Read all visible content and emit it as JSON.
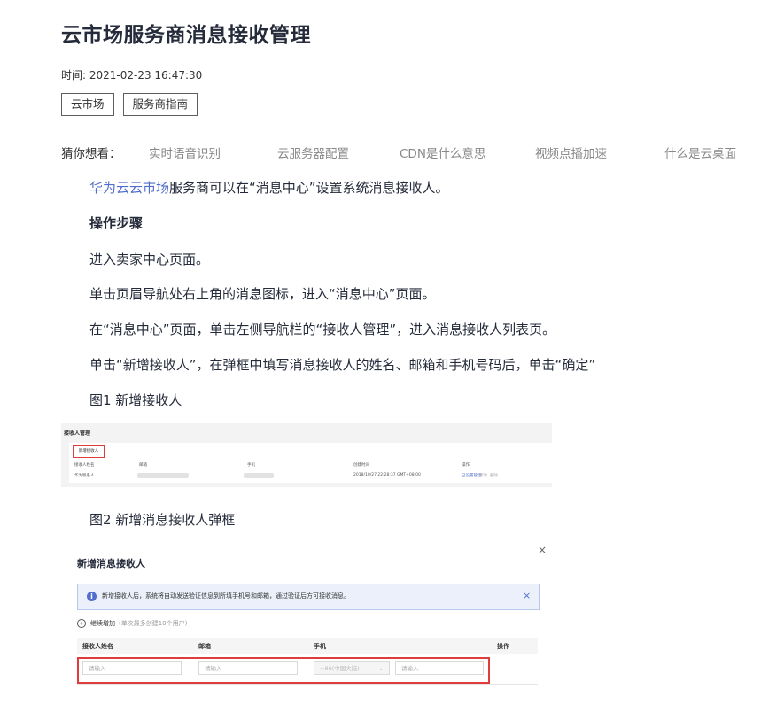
{
  "article": {
    "title": "云市场服务商消息接收管理",
    "time": "时间: 2021-02-23 16:47:30",
    "tags": [
      "云市场",
      "服务商指南"
    ]
  },
  "guess": {
    "label": "猜你想看：",
    "links": [
      "实时语音识别",
      "云服务器配置",
      "CDN是什么意思",
      "视频点播加速",
      "什么是云桌面"
    ]
  },
  "content": {
    "intro_link": "华为云云市场",
    "intro_rest": "服务商可以在“消息中心”设置系统消息接收人。",
    "steps_heading": "操作步骤",
    "step1": "进入卖家中心页面。",
    "step2": "单击页眉导航处右上角的消息图标，进入“消息中心”页面。",
    "step3": "在“消息中心”页面，单击左侧导航栏的“接收人管理”，进入消息接收人列表页。",
    "step4": "单击“新增接收人”，在弹框中填写消息接收人的姓名、邮箱和手机号码后，单击“确定”",
    "fig1_caption": "图1 新增接收人",
    "fig2_caption": "图2 新增消息接收人弹框"
  },
  "fig1": {
    "title": "接收人管理",
    "add_button": "新增接收人",
    "columns": [
      "接收人姓名",
      "邮箱",
      "手机",
      "创建时间",
      "操作"
    ],
    "row": {
      "name": "华为联系人",
      "created": "2018/10/27 22:28:37 GMT+08:00",
      "ops": [
        "已设置管理",
        "修改",
        "删除"
      ]
    }
  },
  "fig2": {
    "close": "×",
    "title": "新增消息接收人",
    "notice": "新增接收人后，系统将自动发送验证信息到所填手机号和邮箱，通过验证后方可接收消息。",
    "notice_close": "×",
    "add_more": "继续增加",
    "add_more_hint": "(单次最多创建10个用户)",
    "columns": [
      "接收人姓名",
      "邮箱",
      "手机",
      "操作"
    ],
    "placeholder": "请输入",
    "country_code": "+86(中国大陆)"
  }
}
